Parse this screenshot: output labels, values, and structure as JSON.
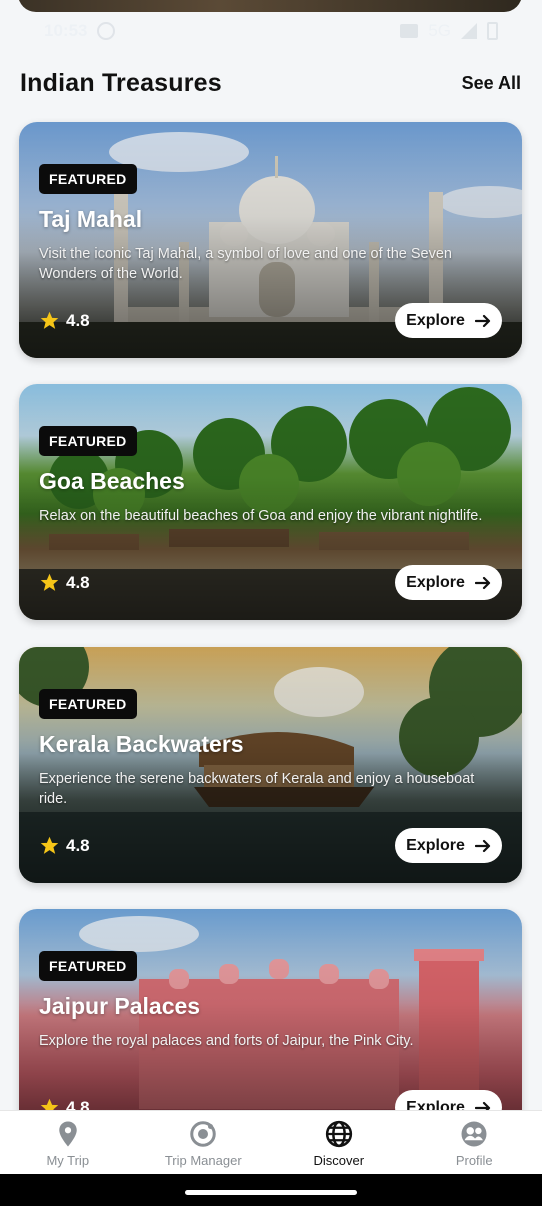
{
  "status": {
    "time": "10:53",
    "signal_text": "5G"
  },
  "header": {
    "title": "Indian Treasures",
    "see_all": "See All"
  },
  "cards": [
    {
      "badge": "FEATURED",
      "title": "Taj Mahal",
      "description": "Visit the iconic Taj Mahal, a symbol of love and one of the Seven Wonders of the World.",
      "rating": "4.8",
      "explore_label": "Explore"
    },
    {
      "badge": "FEATURED",
      "title": "Goa Beaches",
      "description": "Relax on the beautiful beaches of Goa and enjoy the vibrant nightlife.",
      "rating": "4.8",
      "explore_label": "Explore"
    },
    {
      "badge": "FEATURED",
      "title": "Kerala Backwaters",
      "description": "Experience the serene backwaters of Kerala and enjoy a houseboat ride.",
      "rating": "4.8",
      "explore_label": "Explore"
    },
    {
      "badge": "FEATURED",
      "title": "Jaipur Palaces",
      "description": "Explore the royal palaces and forts of Jaipur, the Pink City.",
      "rating": "4.8",
      "explore_label": "Explore"
    }
  ],
  "nav": {
    "items": [
      {
        "label": "My Trip",
        "icon": "location-pin-icon",
        "active": false
      },
      {
        "label": "Trip Manager",
        "icon": "target-circle-icon",
        "active": false
      },
      {
        "label": "Discover",
        "icon": "globe-icon",
        "active": true
      },
      {
        "label": "Profile",
        "icon": "profile-icon",
        "active": false
      }
    ]
  },
  "colors": {
    "accent": "#111111",
    "star": "#f5c518",
    "background": "#f4f6f8"
  }
}
